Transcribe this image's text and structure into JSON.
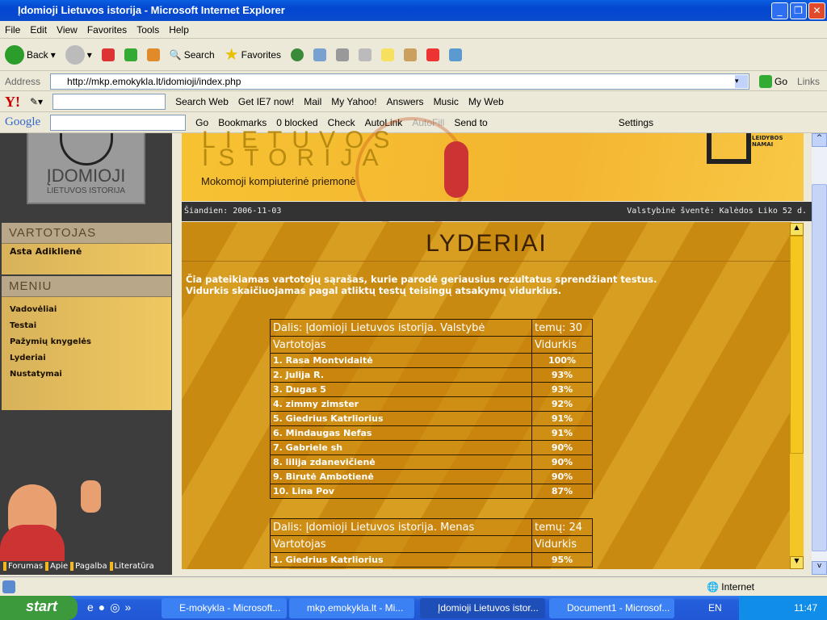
{
  "window": {
    "title": "Įdomioji Lietuvos istorija - Microsoft Internet Explorer"
  },
  "menu": [
    "File",
    "Edit",
    "View",
    "Favorites",
    "Tools",
    "Help"
  ],
  "toolbar": {
    "back": "Back",
    "search": "Search",
    "favorites": "Favorites"
  },
  "address": {
    "label": "Address",
    "url": "http://mkp.emokykla.lt/idomioji/index.php",
    "go": "Go",
    "links": "Links"
  },
  "yahoo": {
    "search_web": "Search Web",
    "get_ie7": "Get IE7 now!",
    "mail": "Mail",
    "my_yahoo": "My Yahoo!",
    "answers": "Answers",
    "music": "Music",
    "my_web": "My Web"
  },
  "google": {
    "go": "Go",
    "bookmarks": "Bookmarks",
    "blocked": "0 blocked",
    "check": "Check",
    "autolink": "AutoLink",
    "autofill": "AutoFill",
    "send_to": "Send to",
    "settings": "Settings"
  },
  "site": {
    "logo_main": "ĮDOMIOJI",
    "logo_sub": "LIETUVOS ISTORIJA",
    "header_title1": "LIETUVOS",
    "header_title2": "ISTORIJA",
    "subtitle": "Mokomoji kompiuterinė priemonė",
    "publisher": "LEIDYBOS NAMAI",
    "today": "Šiandien: 2006-11-03",
    "holiday": "Valstybinė šventė: Kalėdos Liko 52 d."
  },
  "sidebar": {
    "user_title": "VARTOTOJAS",
    "user_name": "Asta Adiklienė",
    "menu_title": "MENIU",
    "items": [
      "Vadovėliai",
      "Testai",
      "Pažymių knygelės",
      "Lyderiai",
      "Nustatymai"
    ],
    "footer_links": [
      "Forumas",
      "Apie",
      "Pagalba",
      "Literatūra"
    ]
  },
  "main": {
    "title": "LYDERIAI",
    "intro1": "Čia pateikiamas vartotojų sąrašas, kurie parodė geriausius rezultatus sprendžiant testus.",
    "intro2": "Vidurkis skaičiuojamas pagal atliktų testų teisingų atsakymų vidurkius.",
    "tables": [
      {
        "section": "Dalis: Įdomioji Lietuvos istorija. Valstybė",
        "topics": "temų: 30",
        "col_user": "Vartotojas",
        "col_avg": "Vidurkis",
        "rows": [
          [
            "1. Rasa Montvidaitė",
            "100%"
          ],
          [
            "2. Julija R.",
            "93%"
          ],
          [
            "3. Dugas 5",
            "93%"
          ],
          [
            "4. zimmy zimster",
            "92%"
          ],
          [
            "5. Giedrius Katrliorius",
            "91%"
          ],
          [
            "6. Mindaugas Nefas",
            "91%"
          ],
          [
            "7. Gabriele sh",
            "90%"
          ],
          [
            "8. lilija zdanevičienė",
            "90%"
          ],
          [
            "9. Birutė Ambotienė",
            "90%"
          ],
          [
            "10. Lina Pov",
            "87%"
          ]
        ]
      },
      {
        "section": "Dalis: Įdomioji Lietuvos istorija. Menas",
        "topics": "temų: 24",
        "col_user": "Vartotojas",
        "col_avg": "Vidurkis",
        "rows": [
          [
            "1. Giedrius Katrliorius",
            "95%"
          ]
        ]
      }
    ]
  },
  "status": {
    "zone": "Internet"
  },
  "taskbar": {
    "start": "start",
    "tasks": [
      "E-mokykla - Microsoft...",
      "mkp.emokykla.lt - Mi...",
      "Įdomioji Lietuvos istor...",
      "Document1 - Microsof..."
    ],
    "lang": "EN",
    "clock": "11:47"
  }
}
